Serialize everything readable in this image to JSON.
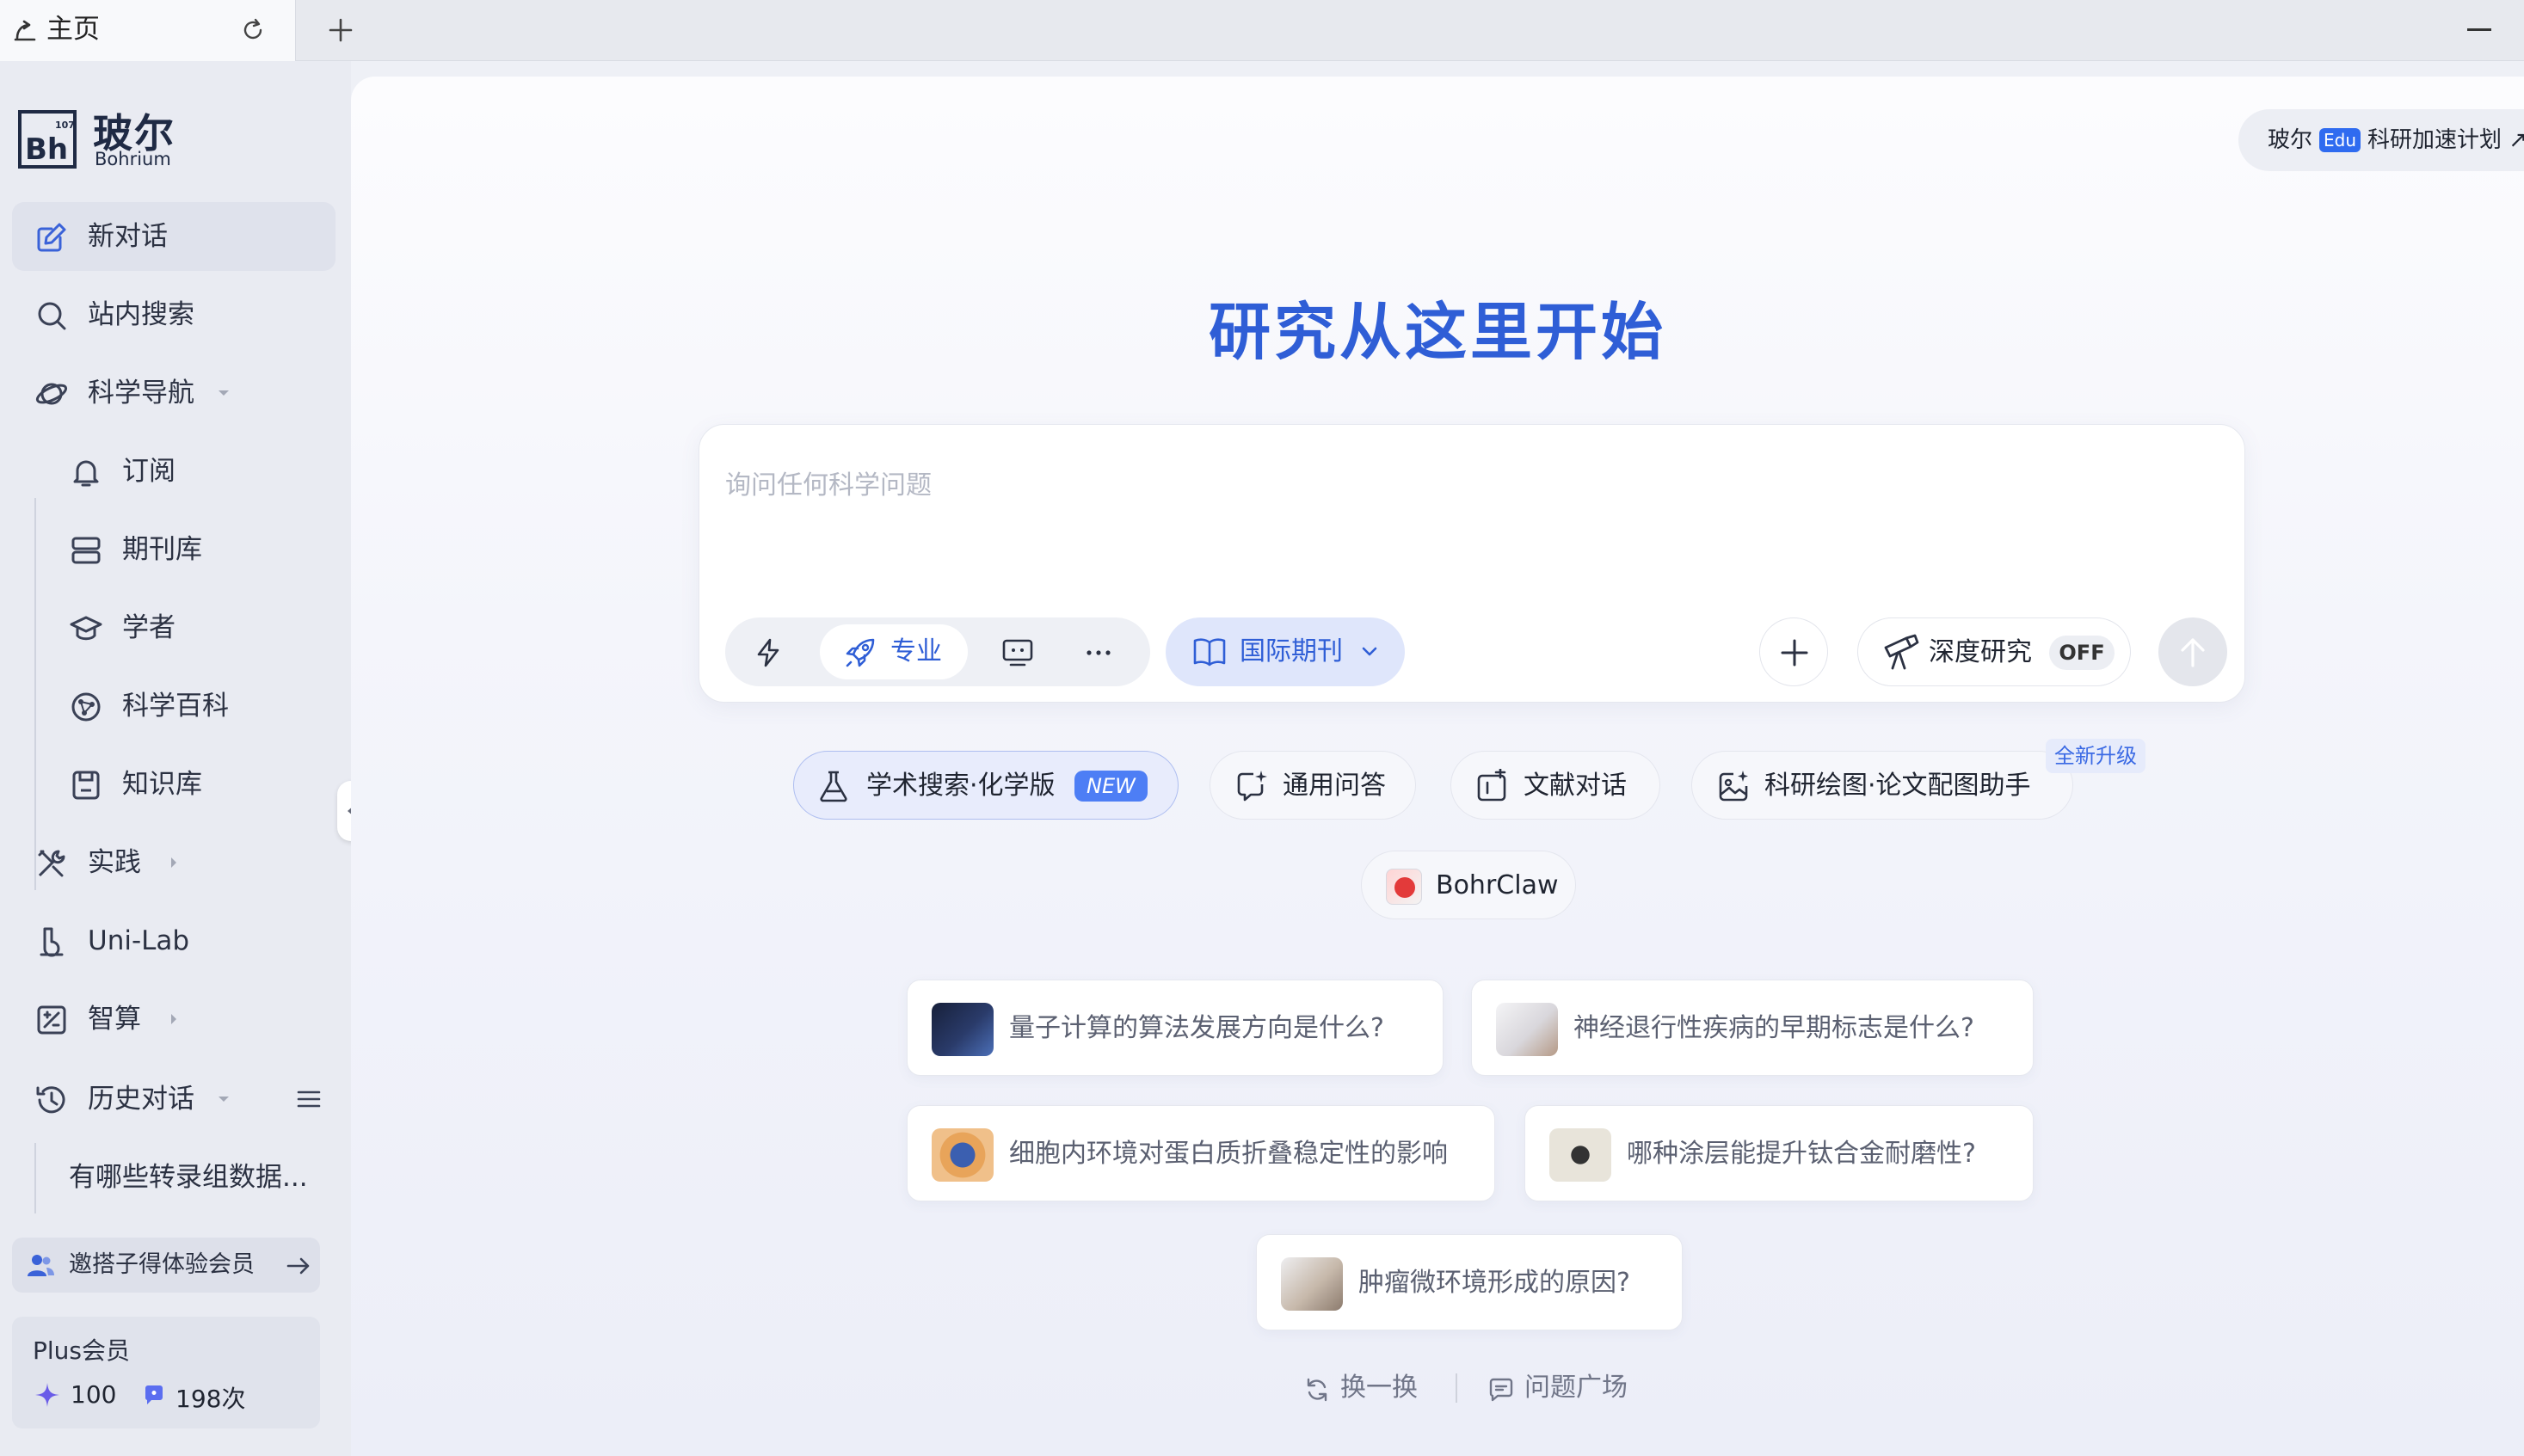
{
  "browser": {
    "tab_title": "主页"
  },
  "sidebar": {
    "brand_cn": "玻尔",
    "brand_en": "Bohrium",
    "logo_text": "Bh",
    "logo_number": "107",
    "items": [
      {
        "label": "新对话",
        "icon": "edit-icon",
        "active": true
      },
      {
        "label": "站内搜索",
        "icon": "search-icon"
      },
      {
        "label": "科学导航",
        "icon": "planet-icon",
        "expandable": "down"
      },
      {
        "label": "订阅",
        "icon": "bell-icon"
      },
      {
        "label": "期刊库",
        "icon": "journal-stack-icon"
      },
      {
        "label": "学者",
        "icon": "graduation-cap-icon"
      },
      {
        "label": "科学百科",
        "icon": "network-icon"
      },
      {
        "label": "知识库",
        "icon": "save-disk-icon"
      },
      {
        "label": "实践",
        "icon": "tools-icon",
        "expandable": "right"
      },
      {
        "label": "Uni-Lab",
        "icon": "lab-icon"
      },
      {
        "label": "智算",
        "icon": "compute-icon",
        "expandable": "right"
      },
      {
        "label": "历史对话",
        "icon": "history-icon",
        "expandable": "down"
      }
    ],
    "history_item": "有哪些转录组数据...",
    "invite_label": "邀搭子得体验会员",
    "plus": {
      "title": "Plus会员",
      "points": "100",
      "chat_count": "198次"
    }
  },
  "main": {
    "promo": {
      "prefix": "玻尔",
      "badge": "Edu",
      "suffix": "科研加速计划 ↗"
    },
    "hero_title": "研究从这里开始",
    "input": {
      "placeholder": "询问任何科学问题",
      "value": ""
    },
    "modes": {
      "pro_label": "专业"
    },
    "journal_label": "国际期刊",
    "deep_research": {
      "label": "深度研究",
      "state": "OFF"
    },
    "chips": {
      "chem": {
        "label": "学术搜索·化学版",
        "badge": "NEW"
      },
      "qa": {
        "label": "通用问答"
      },
      "doc": {
        "label": "文献对话"
      },
      "draw": {
        "label": "科研绘图·论文配图助手",
        "badge": "全新升级"
      },
      "claw": {
        "label": "BohrClaw"
      }
    },
    "suggestions": [
      "量子计算的算法发展方向是什么?",
      "神经退行性疾病的早期标志是什么?",
      "细胞内环境对蛋白质折叠稳定性的影响",
      "哪种涂层能提升钛合金耐磨性?",
      "肿瘤微环境形成的原因?"
    ],
    "footer": {
      "refresh_label": "换一换",
      "plaza_label": "问题广场"
    }
  },
  "colors": {
    "accent": "#2f5ed6",
    "sidebar_bg": "#e9ebf2",
    "new_badge": "#4d7ef5"
  }
}
